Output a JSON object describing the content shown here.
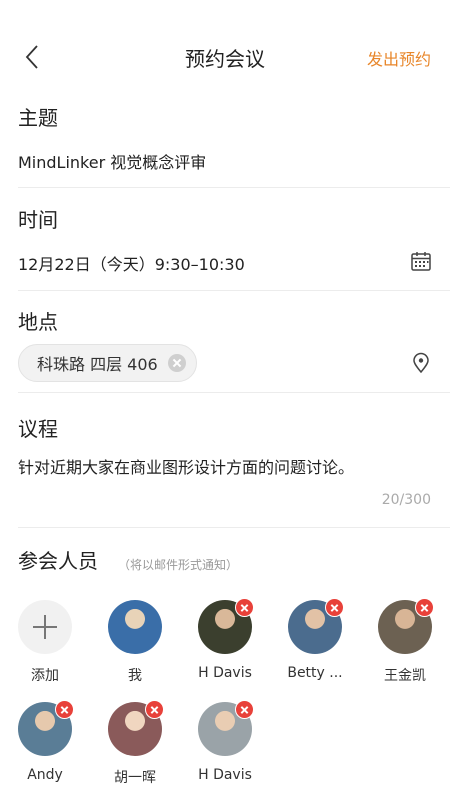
{
  "nav": {
    "title": "预约会议",
    "action": "发出预约"
  },
  "topic": {
    "label": "主题",
    "value": "MindLinker 视觉概念评审"
  },
  "time": {
    "label": "时间",
    "value": "12月22日（今天）9:30–10:30",
    "icon": "calendar-icon"
  },
  "location": {
    "label": "地点",
    "chip": "科珠路 四层 406",
    "icon": "location-pin-icon"
  },
  "agenda": {
    "label": "议程",
    "value": "针对近期大家在商业图形设计方面的问题讨论。",
    "counter": "20/300"
  },
  "members": {
    "label": "参会人员",
    "hint": "（将以邮件形式通知）",
    "add_label": "添加",
    "list": [
      {
        "name": "我",
        "removable": false,
        "color": "#3a6ea8"
      },
      {
        "name": "H Davis",
        "removable": true,
        "color": "#3b3f2e"
      },
      {
        "name": "Betty ...",
        "removable": true,
        "color": "#4b6c8e"
      },
      {
        "name": "王金凯",
        "removable": true,
        "color": "#6c6152"
      },
      {
        "name": "Andy",
        "removable": true,
        "color": "#5a7d96"
      },
      {
        "name": "胡一晖",
        "removable": true,
        "color": "#8a5a5a"
      },
      {
        "name": "H Davis",
        "removable": true,
        "color": "#9aa3a8"
      }
    ]
  },
  "colors": {
    "accent": "#e8862a",
    "remove": "#e8413a"
  }
}
